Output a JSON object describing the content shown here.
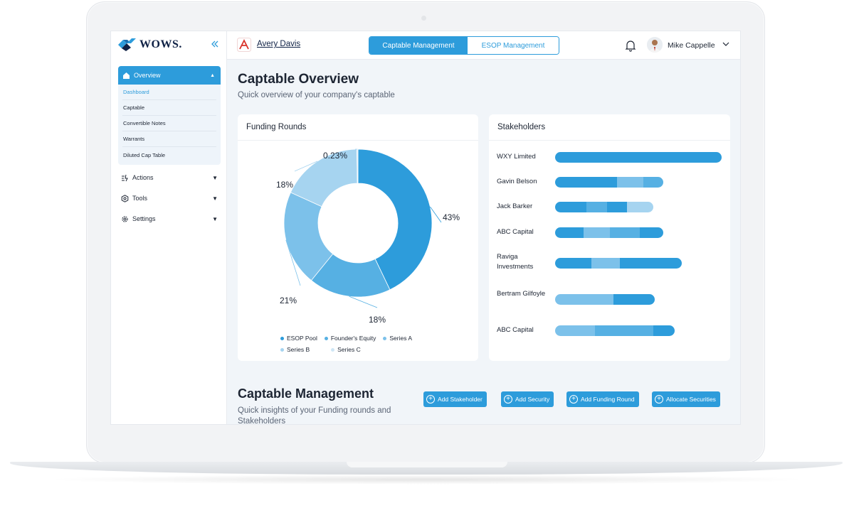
{
  "brand": {
    "name": "WOWS.",
    "collapse_icon": "chevrons-left-icon"
  },
  "sidebar": {
    "overview_label": "Overview",
    "sub_items": [
      "Dashboard",
      "Captable",
      "Convertible Notes",
      "Warrants",
      "Diluted Cap Table"
    ],
    "active_sub_item": "Dashboard",
    "items": [
      {
        "label": "Actions",
        "icon": "actions-icon"
      },
      {
        "label": "Tools",
        "icon": "hexagon-icon"
      },
      {
        "label": "Settings",
        "icon": "gear-icon"
      }
    ]
  },
  "header": {
    "company_name": "Avery Davis",
    "tabs": [
      "Captable Management",
      "ESOP Management"
    ],
    "active_tab": "Captable Management",
    "user_name": "Mike Cappelle"
  },
  "overview": {
    "title": "Captable Overview",
    "subtitle": "Quick overview of your company's captable"
  },
  "funding_card": {
    "title": "Funding Rounds"
  },
  "stakeholders_card": {
    "title": "Stakeholders"
  },
  "chart_data": [
    {
      "type": "pie",
      "title": "Funding Rounds",
      "donut": true,
      "labels": [
        "43%",
        "18%",
        "21%",
        "18%",
        "0.23%"
      ],
      "values": [
        43,
        18,
        21,
        18,
        0.23
      ],
      "slice_colors": [
        "#2d9cdb",
        "#56b0e3",
        "#7cc1ea",
        "#a6d4f0",
        "#cfe6f5"
      ],
      "legend": [
        {
          "name": "ESOP Pool",
          "color": "#2d9cdb"
        },
        {
          "name": "Founder's Equity",
          "color": "#56b0e3"
        },
        {
          "name": "Series A",
          "color": "#7cc1ea"
        },
        {
          "name": "Series B",
          "color": "#a6d4f0"
        },
        {
          "name": "Series C",
          "color": "#cfe6f5"
        }
      ]
    },
    {
      "type": "bar",
      "orientation": "horizontal",
      "stacked": true,
      "title": "Stakeholders",
      "categories": [
        "WXY Limited",
        "Gavin Belson",
        "Jack Barker",
        "ABC Capital",
        "Raviga Investments",
        "Bertram Gilfoyle",
        "ABC Capital"
      ],
      "rows": [
        {
          "segments": [
            {
              "value": 100,
              "color": "#2d9cdb"
            }
          ]
        },
        {
          "segments": [
            {
              "value": 37,
              "color": "#2d9cdb"
            },
            {
              "value": 16,
              "color": "#7cc1ea"
            },
            {
              "value": 12,
              "color": "#56b0e3"
            }
          ]
        },
        {
          "segments": [
            {
              "value": 19,
              "color": "#2d9cdb"
            },
            {
              "value": 12,
              "color": "#56b0e3"
            },
            {
              "value": 12,
              "color": "#2d9cdb"
            },
            {
              "value": 16,
              "color": "#a6d4f0"
            }
          ]
        },
        {
          "segments": [
            {
              "value": 17,
              "color": "#2d9cdb"
            },
            {
              "value": 16,
              "color": "#7cc1ea"
            },
            {
              "value": 18,
              "color": "#56b0e3"
            },
            {
              "value": 14,
              "color": "#2d9cdb"
            }
          ]
        },
        {
          "segments": [
            {
              "value": 22,
              "color": "#2d9cdb"
            },
            {
              "value": 17,
              "color": "#7cc1ea"
            },
            {
              "value": 37,
              "color": "#2d9cdb"
            }
          ]
        },
        {
          "segments": [
            {
              "value": 35,
              "color": "#7cc1ea"
            },
            {
              "value": 25,
              "color": "#2d9cdb"
            }
          ]
        },
        {
          "segments": [
            {
              "value": 24,
              "color": "#7cc1ea"
            },
            {
              "value": 35,
              "color": "#56b0e3"
            },
            {
              "value": 13,
              "color": "#2d9cdb"
            }
          ]
        }
      ]
    }
  ],
  "management": {
    "title": "Captable Management",
    "subtitle": "Quick insights of your Funding rounds and Stakeholders",
    "buttons": [
      "Add Stakeholder",
      "Add Security",
      "Add Funding Round",
      "Allocate Securities"
    ]
  },
  "colors": {
    "accent": "#2d9cdb",
    "text": "#1d2533",
    "page_bg": "#f1f5f9"
  }
}
